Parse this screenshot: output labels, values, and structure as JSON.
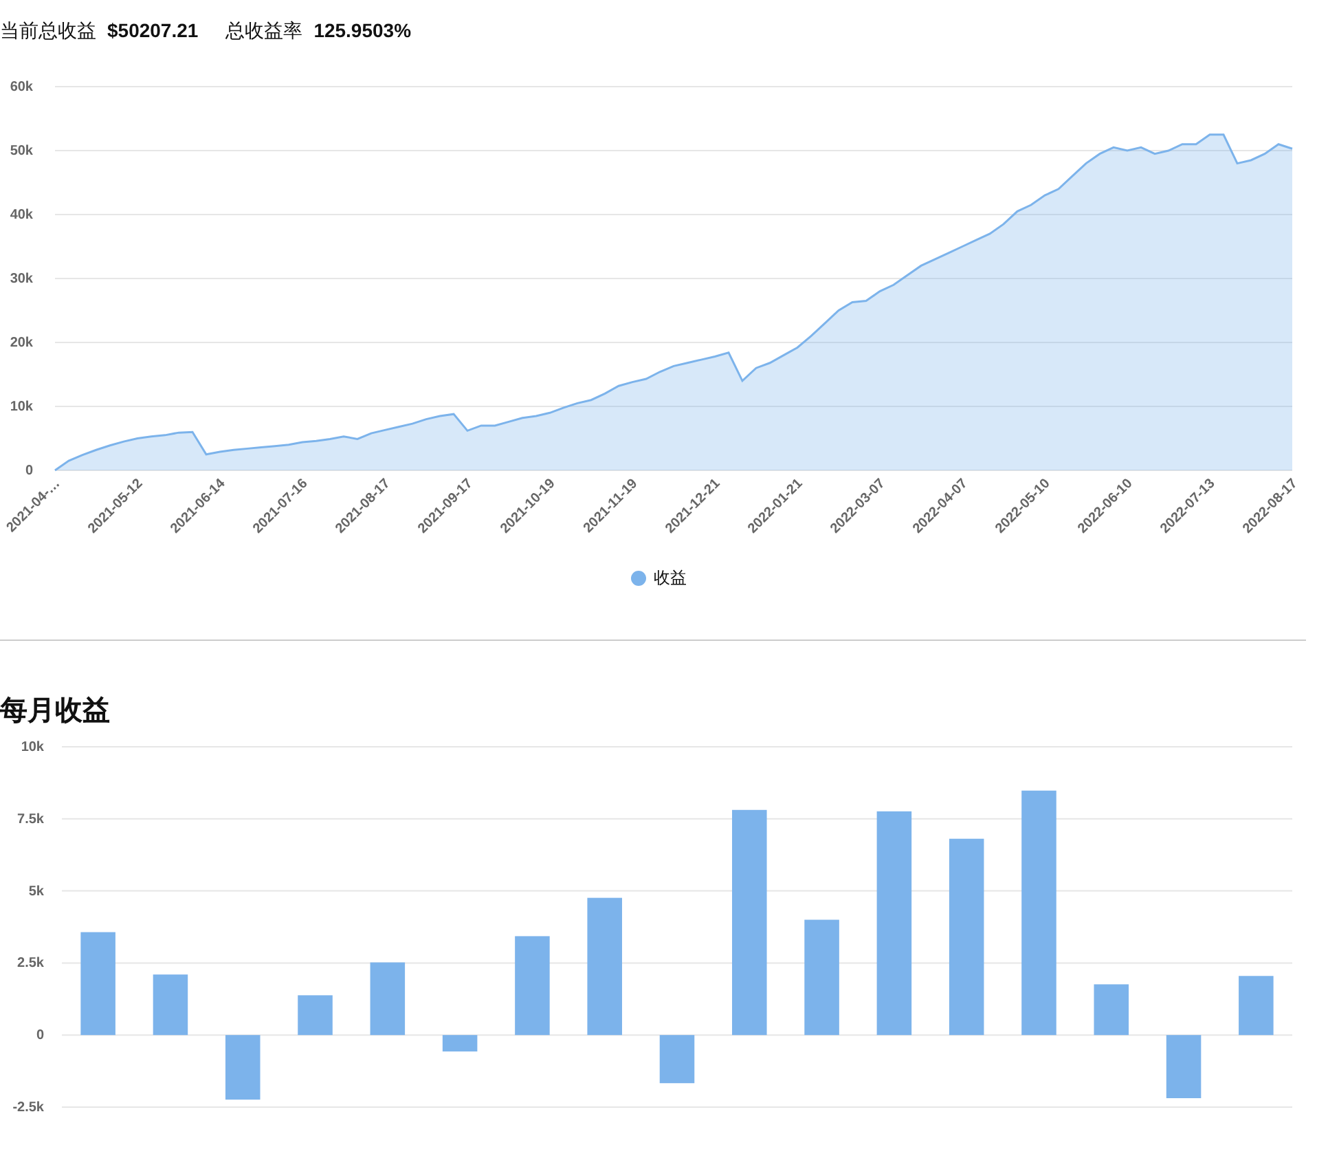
{
  "summary": [
    {
      "label": "当前总收益",
      "value": "$50207.21"
    },
    {
      "label": "总收益率",
      "value": "125.9503%"
    }
  ],
  "profit_chart": {
    "chart_data": {
      "type": "area",
      "grid": true,
      "categories": [
        "2021-04-…",
        null,
        null,
        null,
        null,
        null,
        "2021-05-12",
        null,
        null,
        null,
        null,
        null,
        "2021-06-14",
        null,
        null,
        null,
        null,
        null,
        "2021-07-16",
        null,
        null,
        null,
        null,
        null,
        "2021-08-17",
        null,
        null,
        null,
        null,
        null,
        "2021-09-17",
        null,
        null,
        null,
        null,
        null,
        "2021-10-19",
        null,
        null,
        null,
        null,
        null,
        "2021-11-19",
        null,
        null,
        null,
        null,
        null,
        "2021-12-21",
        null,
        null,
        null,
        null,
        null,
        "2022-01-21",
        null,
        null,
        null,
        null,
        null,
        "2022-03-07",
        null,
        null,
        null,
        null,
        null,
        "2022-04-07",
        null,
        null,
        null,
        null,
        null,
        "2022-05-10",
        null,
        null,
        null,
        null,
        null,
        "2022-06-10",
        null,
        null,
        null,
        null,
        null,
        "2022-07-13",
        null,
        null,
        null,
        null,
        null,
        "2022-08-17"
      ],
      "series": [
        {
          "name": "收益",
          "color": "#7cb3eb",
          "values": [
            0,
            1500,
            2400,
            3200,
            3900,
            4500,
            5000,
            5300,
            5500,
            5900,
            6000,
            2500,
            2900,
            3200,
            3400,
            3600,
            3800,
            4000,
            4400,
            4600,
            4900,
            5300,
            4900,
            5800,
            6300,
            6800,
            7300,
            8000,
            8500,
            8800,
            6200,
            7000,
            7000,
            7600,
            8200,
            8500,
            9000,
            9800,
            10500,
            11000,
            12000,
            13200,
            13800,
            14300,
            15400,
            16300,
            16800,
            17300,
            17800,
            18400,
            14000,
            16000,
            16800,
            18000,
            19200,
            21000,
            23000,
            25000,
            26300,
            26500,
            28000,
            29000,
            30500,
            32000,
            33000,
            34000,
            35000,
            36000,
            37000,
            38500,
            40500,
            41500,
            43000,
            44000,
            46000,
            48000,
            49500,
            50500,
            50000,
            50500,
            49500,
            50000,
            51000,
            51000,
            52500,
            52500,
            48000,
            48500,
            49500,
            51000,
            50300
          ]
        }
      ],
      "ylim": [
        0,
        60000
      ],
      "yticks": [
        {
          "value": 0,
          "label": "0"
        },
        {
          "value": 10000,
          "label": "10k"
        },
        {
          "value": 20000,
          "label": "20k"
        },
        {
          "value": 30000,
          "label": "30k"
        },
        {
          "value": 40000,
          "label": "40k"
        },
        {
          "value": 50000,
          "label": "50k"
        },
        {
          "value": 60000,
          "label": "60k"
        }
      ]
    }
  },
  "monthly_chart": {
    "chart_data": {
      "type": "bar",
      "grid": true,
      "title": "每月收益",
      "series": [
        {
          "color": "#7cb3eb",
          "values": [
            3570,
            2100,
            -2240,
            1380,
            2520,
            -570,
            3430,
            4760,
            -1670,
            7810,
            4000,
            7760,
            6810,
            8480,
            1760,
            -2190,
            2050
          ]
        }
      ],
      "ylim": [
        -2500,
        10000
      ],
      "yticks": [
        {
          "value": -2500,
          "label": "-2.5k"
        },
        {
          "value": 0,
          "label": "0"
        },
        {
          "value": 2500,
          "label": "2.5k"
        },
        {
          "value": 5000,
          "label": "5k"
        },
        {
          "value": 7500,
          "label": "7.5k"
        },
        {
          "value": 10000,
          "label": "10k"
        }
      ]
    }
  }
}
